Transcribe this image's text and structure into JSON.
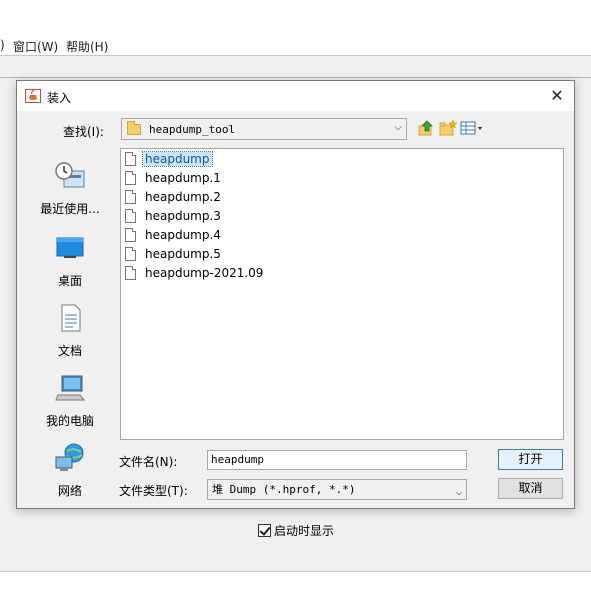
{
  "app": {
    "menu": [
      "窗口(W)",
      "帮助(H)"
    ],
    "menu_partial_prefix": ")",
    "startup_checkbox_label": "启动时显示",
    "startup_checkbox_checked": true
  },
  "dialog": {
    "title": "装入",
    "close_glyph": "✕",
    "look_in_label": "查找(I):",
    "look_in_value": "heapdump_tool",
    "files": [
      {
        "name": "heapdump",
        "selected": true
      },
      {
        "name": "heapdump.1",
        "selected": false
      },
      {
        "name": "heapdump.2",
        "selected": false
      },
      {
        "name": "heapdump.3",
        "selected": false
      },
      {
        "name": "heapdump.4",
        "selected": false
      },
      {
        "name": "heapdump.5",
        "selected": false
      },
      {
        "name": "heapdump-2021.09",
        "selected": false
      }
    ],
    "places": [
      {
        "label": "最近使用...",
        "icon": "recent-items-icon"
      },
      {
        "label": "桌面",
        "icon": "desktop-icon"
      },
      {
        "label": "文档",
        "icon": "documents-icon"
      },
      {
        "label": "我的电脑",
        "icon": "computer-icon"
      },
      {
        "label": "网络",
        "icon": "network-icon"
      }
    ],
    "file_name_label": "文件名(N):",
    "file_name_value": "heapdump",
    "file_type_label": "文件类型(T):",
    "file_type_value": "堆 Dump (*.hprof, *.*)",
    "open_button": "打开",
    "cancel_button": "取消"
  },
  "colors": {
    "selection_bg": "#cde4f7",
    "default_button_border": "#3c7fb1",
    "folder": "#f4cf6b"
  }
}
